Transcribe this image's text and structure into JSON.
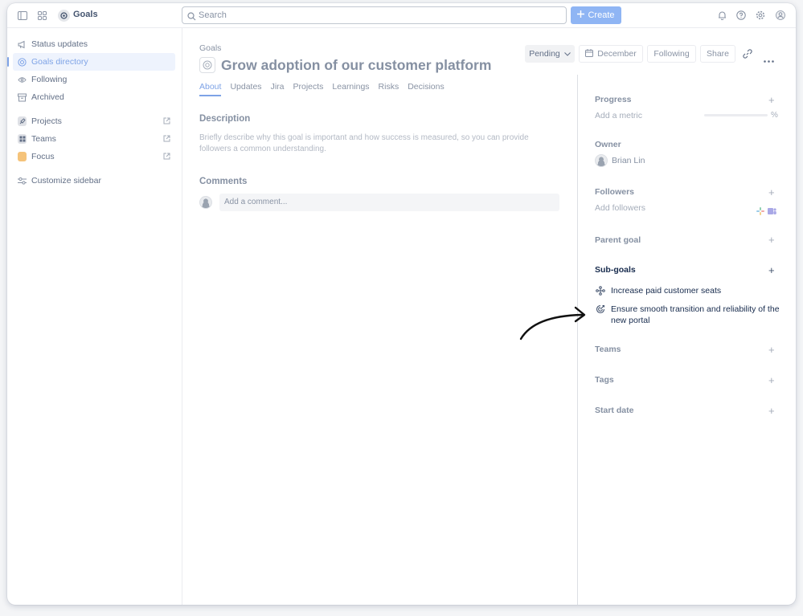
{
  "topbar": {
    "app_name": "Goals",
    "search_placeholder": "Search",
    "create_label": "Create",
    "icons": [
      "sidebar-toggle-icon",
      "app-switcher-icon",
      "notifications-icon",
      "help-icon",
      "settings-icon",
      "profile-icon"
    ]
  },
  "sidebar": {
    "items": [
      {
        "label": "Status updates",
        "icon": "megaphone-icon"
      },
      {
        "label": "Goals directory",
        "icon": "goal-target-icon",
        "active": true
      },
      {
        "label": "Following",
        "icon": "eye-icon"
      },
      {
        "label": "Archived",
        "icon": "archive-icon"
      }
    ],
    "apps": [
      {
        "label": "Projects",
        "icon": "projects-icon"
      },
      {
        "label": "Teams",
        "icon": "teams-icon"
      },
      {
        "label": "Focus",
        "icon": "focus-icon"
      }
    ],
    "customize_label": "Customize sidebar"
  },
  "goal": {
    "breadcrumb": "Goals",
    "title": "Grow adoption of our customer platform",
    "status": "Pending",
    "date": "December",
    "following_label": "Following",
    "share_label": "Share",
    "tabs": [
      "About",
      "Updates",
      "Jira",
      "Projects",
      "Learnings",
      "Risks",
      "Decisions"
    ],
    "active_tab": "About",
    "description_heading": "Description",
    "description_placeholder": "Briefly describe why this goal is important and how success is measured, so you can provide followers a common understanding.",
    "comments_heading": "Comments",
    "comment_placeholder": "Add a comment..."
  },
  "details": {
    "progress_label": "Progress",
    "add_metric": "Add a metric",
    "progress_value": 0,
    "progress_unit": "%",
    "owner_label": "Owner",
    "owner_name": "Brian Lin",
    "followers_label": "Followers",
    "add_followers": "Add followers",
    "parent_goal_label": "Parent goal",
    "subgoals_label": "Sub-goals",
    "subgoals": [
      {
        "title": "Increase paid customer seats",
        "icon": "subgoal-tree-icon"
      },
      {
        "title": "Ensure smooth transition and reliability of the new portal",
        "icon": "subgoal-target-icon"
      }
    ],
    "teams_label": "Teams",
    "tags_label": "Tags",
    "start_date_label": "Start date"
  },
  "colors": {
    "accent": "#7ea3e6",
    "create": "#8fb5f4",
    "focus": "#f5c37a"
  }
}
